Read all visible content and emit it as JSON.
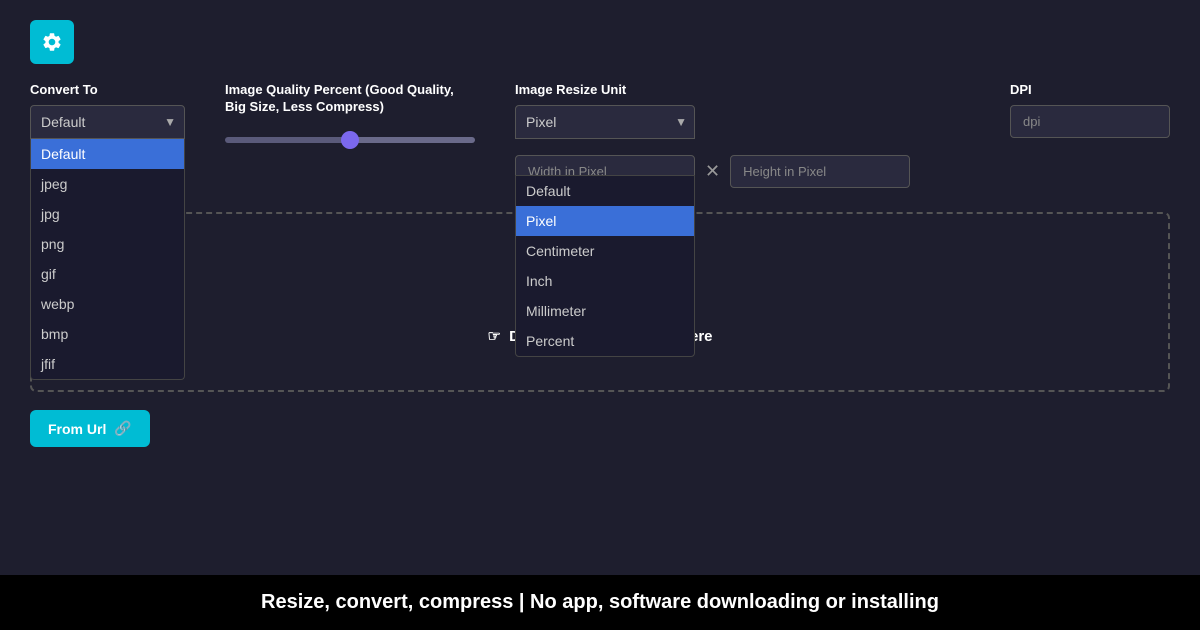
{
  "settings_icon": "gear-icon",
  "convert_to": {
    "label": "Convert To",
    "selected": "Default",
    "options": [
      "Default",
      "jpeg",
      "jpg",
      "png",
      "gif",
      "webp",
      "bmp",
      "jfif"
    ]
  },
  "quality": {
    "label": "Image Quality Percent (Good Quality, Big Size, Less Compress)",
    "value": 50
  },
  "resize_unit": {
    "label": "Image Resize Unit",
    "selected": "Pixel",
    "options": [
      "Default",
      "Pixel",
      "Centimeter",
      "Inch",
      "Millimeter",
      "Percent"
    ]
  },
  "dpi": {
    "label": "DPI",
    "placeholder": "dpi"
  },
  "width_input": {
    "placeholder": "Width in Pixel"
  },
  "height_input": {
    "placeholder": "Height in Pixel"
  },
  "drop_zone": {
    "text": "Drag and Drop Or Click Here"
  },
  "from_url_button": "From Url",
  "footer": "Resize, convert, compress | No app, software downloading or installing"
}
